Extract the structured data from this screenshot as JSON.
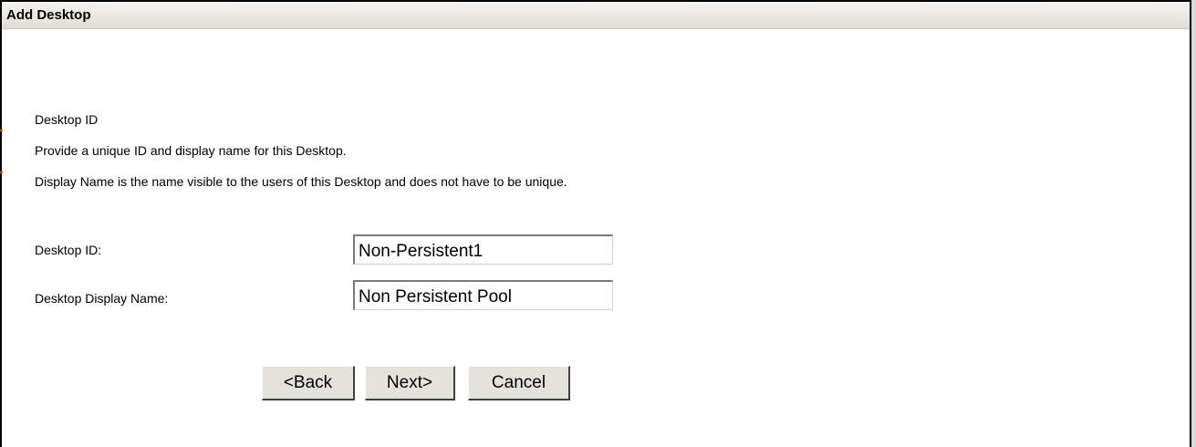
{
  "dialog": {
    "title": "Add Desktop"
  },
  "intro": {
    "heading": "Desktop ID",
    "line1": "Provide a unique ID and display name for this Desktop.",
    "line2": "Display Name is the name visible to the users of this Desktop and does not have to be unique."
  },
  "form": {
    "desktop_id_label": "Desktop ID:",
    "desktop_id_value": "Non-Persistent1",
    "display_name_label": "Desktop Display Name:",
    "display_name_value": "Non Persistent Pool"
  },
  "buttons": {
    "back_label": "<Back",
    "next_label": "Next>",
    "cancel_label": "Cancel"
  },
  "colors": {
    "title_bar": "#e1ded7",
    "button_face": "#e4e2dc"
  }
}
